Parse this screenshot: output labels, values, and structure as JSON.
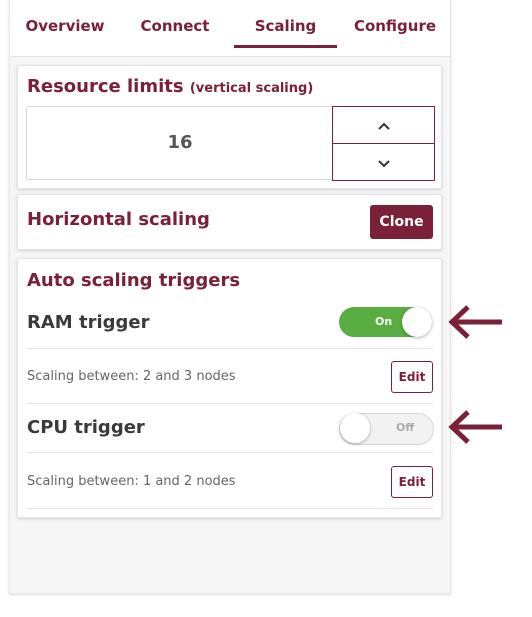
{
  "tabs": [
    {
      "label": "Overview"
    },
    {
      "label": "Connect"
    },
    {
      "label": "Scaling"
    },
    {
      "label": "Configure"
    }
  ],
  "active_tab": "Scaling",
  "resource_limits": {
    "title": "Resource limits",
    "subtitle": "(vertical scaling)",
    "value": "16",
    "up_icon": "chevron-up-icon",
    "down_icon": "chevron-down-icon"
  },
  "horizontal_scaling": {
    "title": "Horizontal scaling",
    "clone_label": "Clone"
  },
  "auto_scaling": {
    "title": "Auto scaling triggers",
    "triggers": [
      {
        "label": "RAM trigger",
        "toggle_text": "On",
        "enabled": true,
        "range_text": "Scaling between: 2 and 3 nodes",
        "edit_label": "Edit"
      },
      {
        "label": "CPU trigger",
        "toggle_text": "Off",
        "enabled": false,
        "range_text": "Scaling between: 1 and 2 nodes",
        "edit_label": "Edit"
      }
    ]
  },
  "annotation_arrow_icon": "arrow-left-icon",
  "colors": {
    "accent": "#7a2038",
    "toggle_on": "#5aad42",
    "toggle_off": "#f2f2f2"
  }
}
